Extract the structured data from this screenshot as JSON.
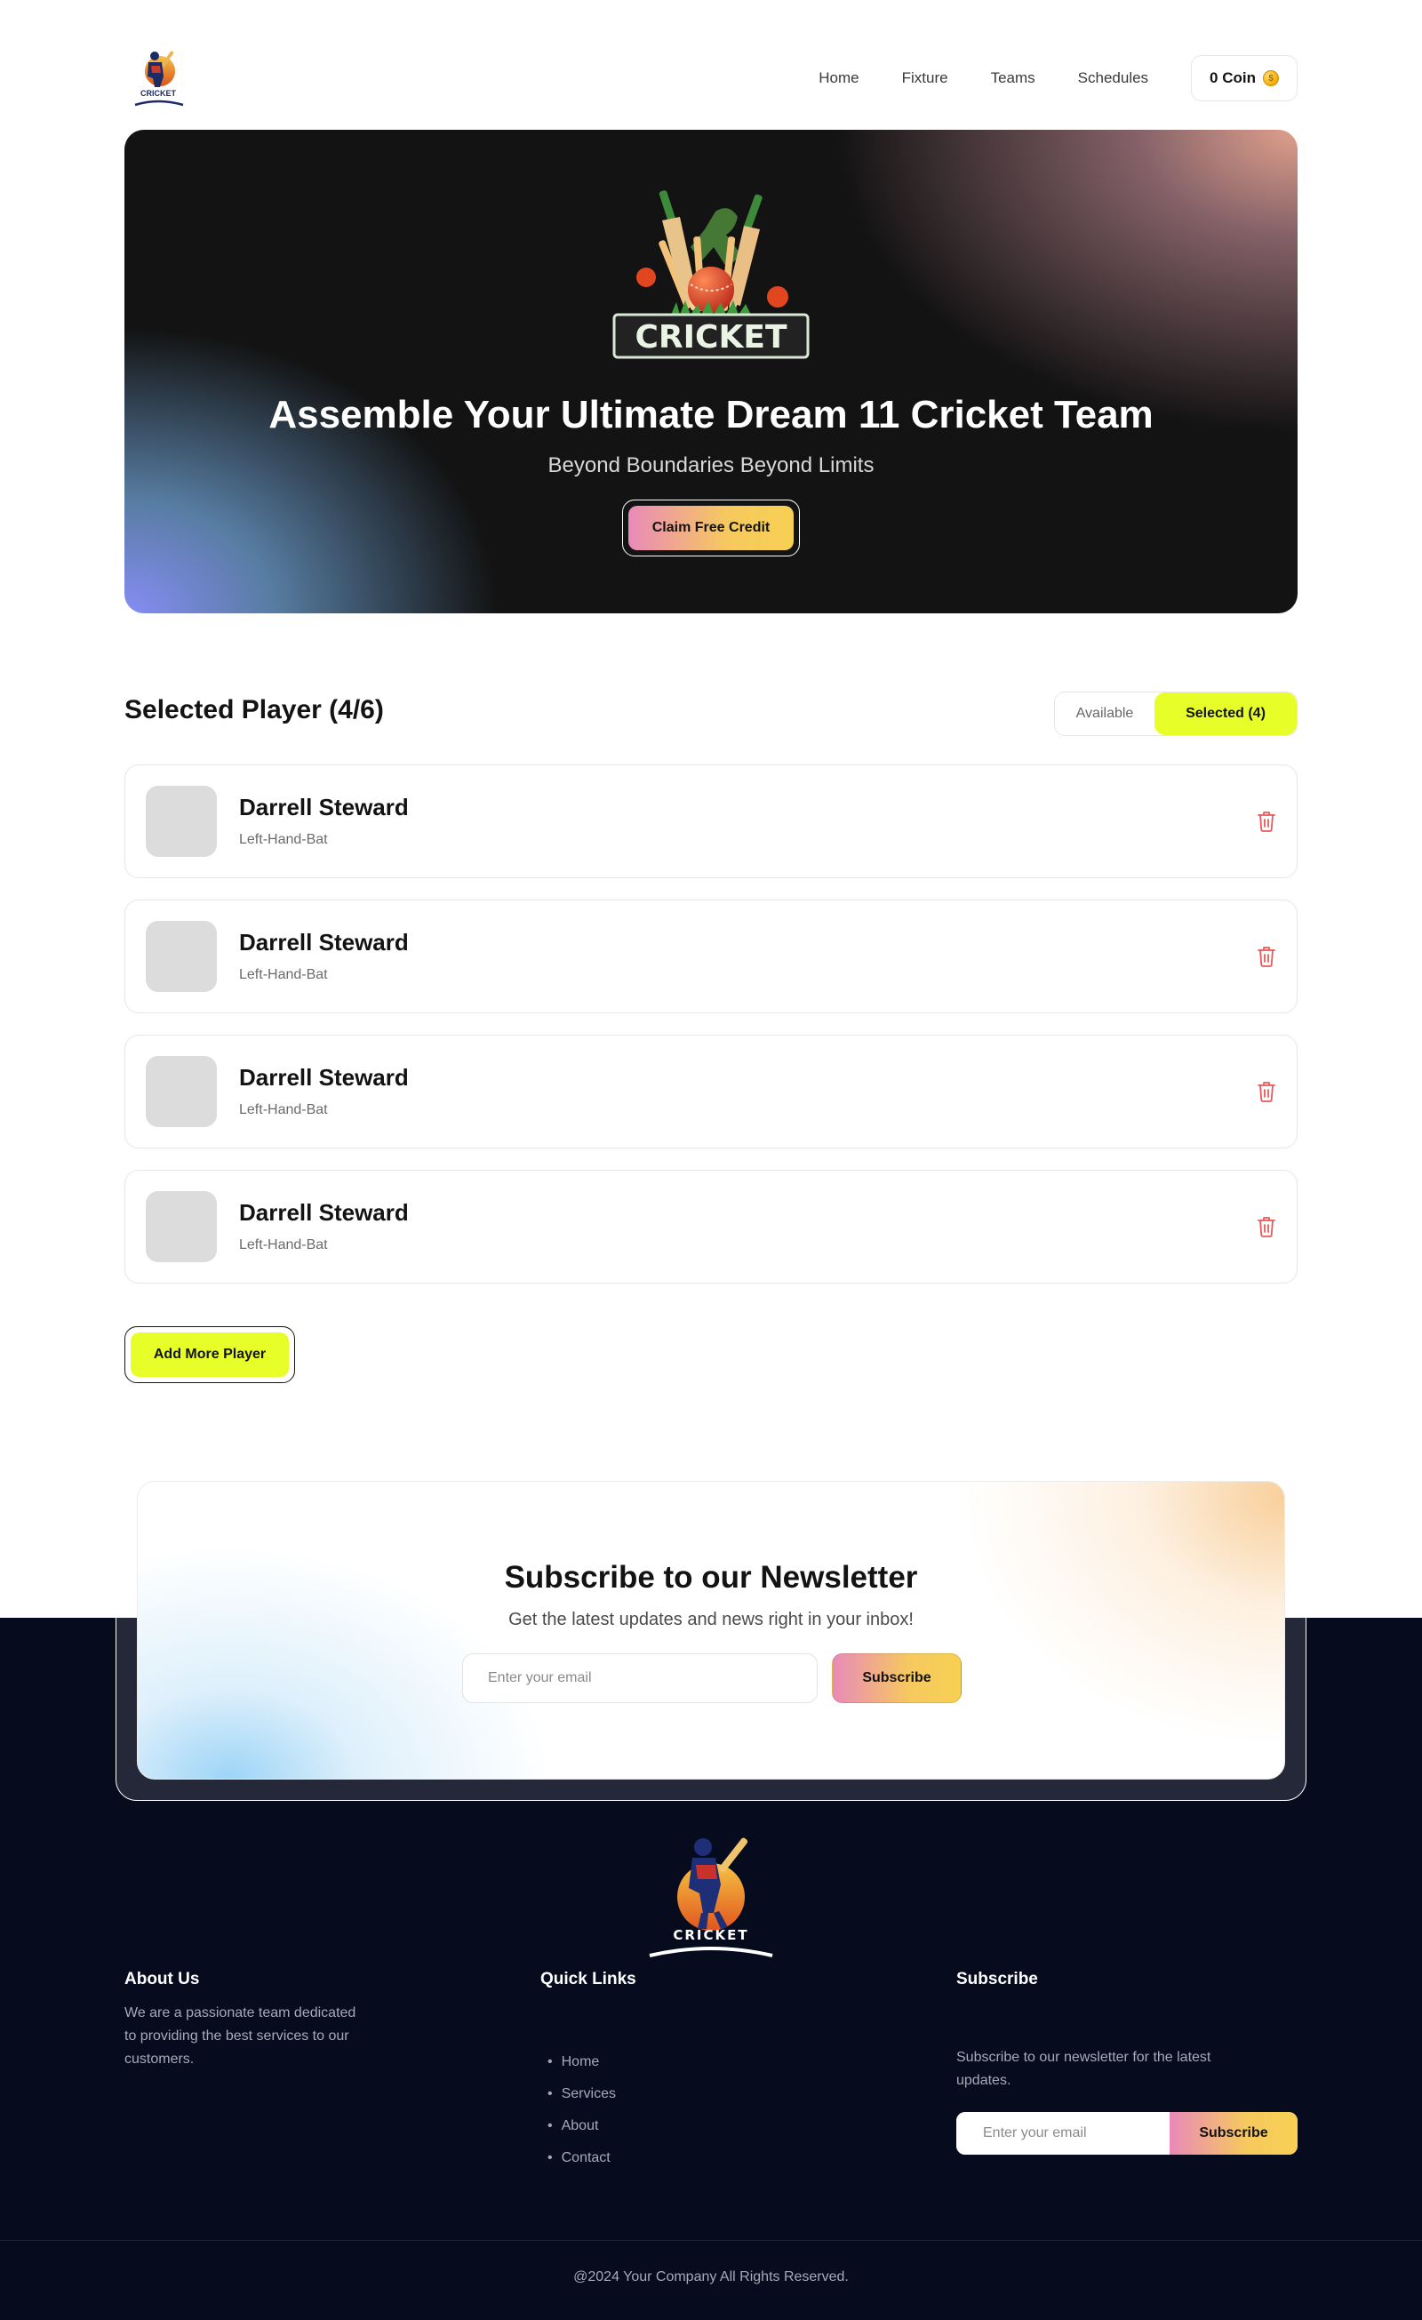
{
  "nav": {
    "logo_text": "CRICKET",
    "links": [
      "Home",
      "Fixture",
      "Teams",
      "Schedules"
    ],
    "coin_label": "0 Coin",
    "coin_symbol": "$"
  },
  "hero": {
    "logo_text": "CRICKET",
    "title": "Assemble Your Ultimate Dream 11 Cricket Team",
    "subtitle": "Beyond Boundaries Beyond Limits",
    "cta_label": "Claim Free Credit"
  },
  "selected": {
    "title": "Selected Player (4/6)",
    "toggle_available": "Available",
    "toggle_selected": "Selected (4)",
    "players": [
      {
        "name": "Darrell Steward",
        "role": "Left-Hand-Bat"
      },
      {
        "name": "Darrell Steward",
        "role": "Left-Hand-Bat"
      },
      {
        "name": "Darrell Steward",
        "role": "Left-Hand-Bat"
      },
      {
        "name": "Darrell Steward",
        "role": "Left-Hand-Bat"
      }
    ],
    "add_label": "Add More Player"
  },
  "newsletter": {
    "title": "Subscribe to our Newsletter",
    "subtitle": "Get the latest updates and news right in your inbox!",
    "placeholder": "Enter your email",
    "button": "Subscribe"
  },
  "footer": {
    "logo_text": "CRICKET",
    "about_title": "About Us",
    "about_text": "We are a passionate team dedicated to providing the best services to our customers.",
    "links_title": "Quick Links",
    "links": [
      "Home",
      "Services",
      "About",
      "Contact"
    ],
    "subscribe_title": "Subscribe",
    "subscribe_text": "Subscribe to our newsletter for the latest updates.",
    "subscribe_placeholder": "Enter your email",
    "subscribe_button": "Subscribe",
    "copyright": "@2024 Your Company All Rights Reserved."
  },
  "colors": {
    "accent_lime": "#e7fe29",
    "dark": "#131313",
    "footer_bg": "#060b1e",
    "delete_red": "#e85a5a"
  }
}
